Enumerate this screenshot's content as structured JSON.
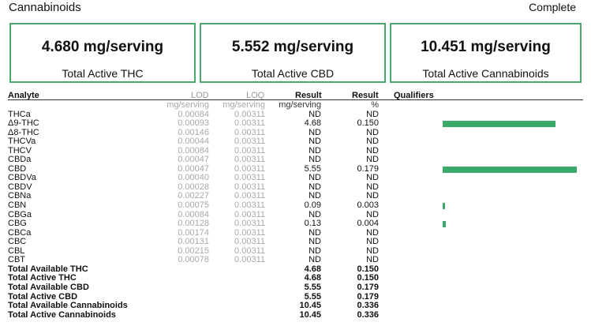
{
  "header": {
    "title": "Cannabinoids",
    "status": "Complete"
  },
  "summary": [
    {
      "value": "4.680 mg/serving",
      "label": "Total Active THC"
    },
    {
      "value": "5.552 mg/serving",
      "label": "Total Active CBD"
    },
    {
      "value": "10.451 mg/serving",
      "label": "Total Active Cannabinoids"
    }
  ],
  "table": {
    "headers": {
      "analyte": "Analyte",
      "lod": "LOD",
      "loq": "LOQ",
      "result": "Result",
      "result_pct": "Result",
      "qualifiers": "Qualifiers"
    },
    "units": {
      "lod": "mg/serving",
      "loq": "mg/serving",
      "result": "mg/serving",
      "result_pct": "%"
    },
    "rows": [
      {
        "name": "THCa",
        "lod": "0.00084",
        "loq": "0.00311",
        "result": "ND",
        "pct": "ND",
        "bar": 0
      },
      {
        "name": "Δ9-THC",
        "lod": "0.00093",
        "loq": "0.00311",
        "result": "4.68",
        "pct": "0.150",
        "bar": 0.84
      },
      {
        "name": "Δ8-THC",
        "lod": "0.00146",
        "loq": "0.00311",
        "result": "ND",
        "pct": "ND",
        "bar": 0
      },
      {
        "name": "THCVa",
        "lod": "0.00044",
        "loq": "0.00311",
        "result": "ND",
        "pct": "ND",
        "bar": 0
      },
      {
        "name": "THCV",
        "lod": "0.00084",
        "loq": "0.00311",
        "result": "ND",
        "pct": "ND",
        "bar": 0
      },
      {
        "name": "CBDa",
        "lod": "0.00047",
        "loq": "0.00311",
        "result": "ND",
        "pct": "ND",
        "bar": 0
      },
      {
        "name": "CBD",
        "lod": "0.00047",
        "loq": "0.00311",
        "result": "5.55",
        "pct": "0.179",
        "bar": 1.0
      },
      {
        "name": "CBDVa",
        "lod": "0.00040",
        "loq": "0.00311",
        "result": "ND",
        "pct": "ND",
        "bar": 0
      },
      {
        "name": "CBDV",
        "lod": "0.00028",
        "loq": "0.00311",
        "result": "ND",
        "pct": "ND",
        "bar": 0
      },
      {
        "name": "CBNa",
        "lod": "0.00227",
        "loq": "0.00311",
        "result": "ND",
        "pct": "ND",
        "bar": 0
      },
      {
        "name": "CBN",
        "lod": "0.00075",
        "loq": "0.00311",
        "result": "0.09",
        "pct": "0.003",
        "bar": 0.017
      },
      {
        "name": "CBGa",
        "lod": "0.00084",
        "loq": "0.00311",
        "result": "ND",
        "pct": "ND",
        "bar": 0
      },
      {
        "name": "CBG",
        "lod": "0.00128",
        "loq": "0.00311",
        "result": "0.13",
        "pct": "0.004",
        "bar": 0.023
      },
      {
        "name": "CBCa",
        "lod": "0.00174",
        "loq": "0.00311",
        "result": "ND",
        "pct": "ND",
        "bar": 0
      },
      {
        "name": "CBC",
        "lod": "0.00131",
        "loq": "0.00311",
        "result": "ND",
        "pct": "ND",
        "bar": 0
      },
      {
        "name": "CBL",
        "lod": "0.00215",
        "loq": "0.00311",
        "result": "ND",
        "pct": "ND",
        "bar": 0
      },
      {
        "name": "CBT",
        "lod": "0.00078",
        "loq": "0.00311",
        "result": "ND",
        "pct": "ND",
        "bar": 0
      }
    ],
    "totals": [
      {
        "name": "Total Available THC",
        "result": "4.68",
        "pct": "0.150"
      },
      {
        "name": "Total Active THC",
        "result": "4.68",
        "pct": "0.150"
      },
      {
        "name": "Total Available CBD",
        "result": "5.55",
        "pct": "0.179"
      },
      {
        "name": "Total Active CBD",
        "result": "5.55",
        "pct": "0.179"
      },
      {
        "name": "Total Available Cannabinoids",
        "result": "10.45",
        "pct": "0.336"
      },
      {
        "name": "Total Active Cannabinoids",
        "result": "10.45",
        "pct": "0.336"
      }
    ]
  },
  "colors": {
    "accent": "#4aa86d",
    "bar": "#3aaa6a",
    "muted": "#a8a8a8"
  }
}
